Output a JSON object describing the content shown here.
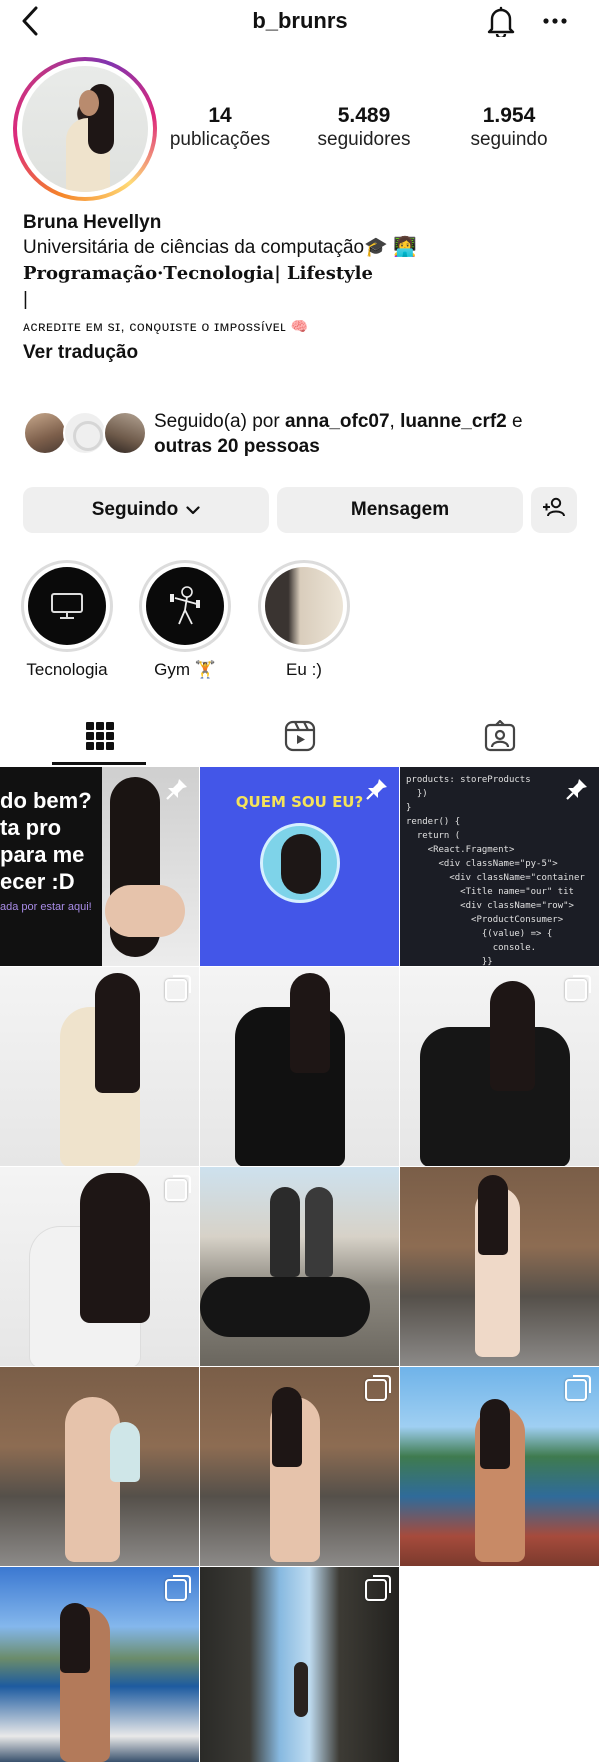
{
  "topbar": {
    "username": "b_brunrs"
  },
  "profile": {
    "stats": [
      {
        "value": "14",
        "label": "publicações"
      },
      {
        "value": "5.489",
        "label": "seguidores"
      },
      {
        "value": "1.954",
        "label": "seguindo"
      }
    ],
    "name": "Bruna Hevellyn",
    "bio_lines": [
      "Universitária de ciências da computação🎓 👩‍💻",
      "𝐏𝐫𝐨𝐠𝐫𝐚𝐦𝐚çã𝐨·𝐓𝐞𝐜𝐧𝐨𝐥𝐨𝐠𝐢𝐚| 𝐋𝐢𝐟𝐞𝐬𝐭𝐲𝐥𝐞",
      "|",
      "ᴀᴄʀᴇᴅɪᴛᴇ ᴇᴍ sɪ, ᴄᴏɴǫᴜɪsᴛᴇ ᴏ ɪᴍᴘᴏssíᴠᴇʟ 🧠"
    ],
    "translate_link": "Ver tradução"
  },
  "followed_by": {
    "prefix": "Seguido(a) por ",
    "user1": "anna_ofc07",
    "sep": ", ",
    "user2": "luanne_crf2",
    "conj": " e",
    "others": "outras 20 pessoas"
  },
  "actions": {
    "following_label": "Seguindo",
    "message_label": "Mensagem"
  },
  "highlights": [
    {
      "label": "Tecnologia"
    },
    {
      "label": "Gym 🏋️"
    },
    {
      "label": "Eu :)"
    }
  ],
  "tabs": [
    "grid-icon",
    "reels-icon",
    "tagged-icon"
  ],
  "posts": {
    "p0_text": "do bem?\nta pro\npara me\necer :D",
    "p0_sub": "ada por estar aqui!",
    "p1_title": "QUEM SOU EU?",
    "p2_code": "products: storeProducts\n  })\n}\nrender() {\n  return (\n    <React.Fragment>\n      <div className=\"py-5\">\n        <div className=\"container\n          <Title name=\"our\" tit\n          <div className=\"row\">\n            <ProductConsumer>\n              {(value) => {\n                console.\n              }}\n            </ProductConsumer\n          </div>\n        </div>\n      </div>\n    </React.Fragment>"
  },
  "colors": {
    "accent_ring_start": "#f58529",
    "accent_ring_end": "#dd2a7b",
    "button_bg": "#efefef"
  }
}
